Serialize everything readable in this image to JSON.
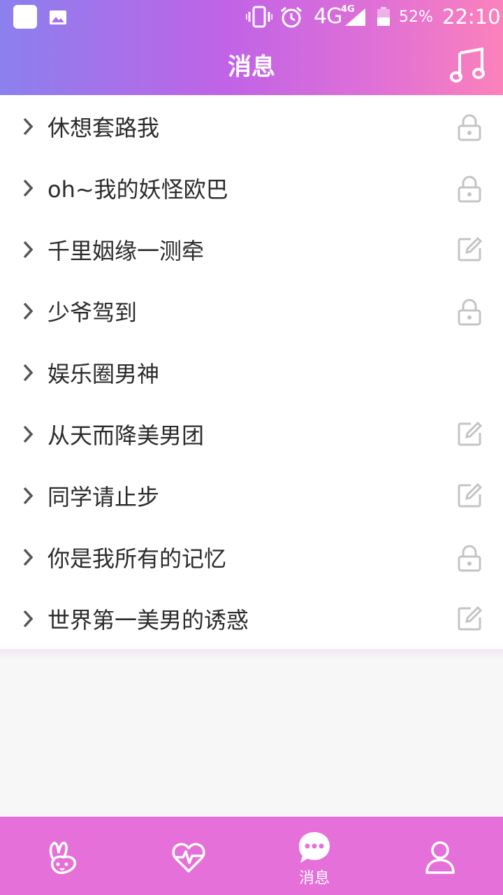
{
  "status_bar": {
    "network": "4G",
    "network_small": "4G",
    "battery": "52%",
    "time": "22:10",
    "icons": [
      "app-icon",
      "image-icon",
      "vibrate-icon",
      "alarm-icon",
      "signal-icon",
      "battery-icon"
    ]
  },
  "header": {
    "title": "消息",
    "action_icon": "music-note-icon"
  },
  "messages": [
    {
      "label": "休想套路我",
      "icon": "lock-icon"
    },
    {
      "label": "oh~我的妖怪欧巴",
      "icon": "lock-icon"
    },
    {
      "label": "千里姻缘一测牵",
      "icon": "edit-icon"
    },
    {
      "label": "少爷驾到",
      "icon": "lock-icon"
    },
    {
      "label": "娱乐圈男神",
      "icon": ""
    },
    {
      "label": "从天而降美男团",
      "icon": "edit-icon"
    },
    {
      "label": "同学请止步",
      "icon": "edit-icon"
    },
    {
      "label": "你是我所有的记忆",
      "icon": "lock-icon"
    },
    {
      "label": "世界第一美男的诱惑",
      "icon": "edit-icon"
    }
  ],
  "tabbar": {
    "tabs": [
      {
        "icon": "rabbit-icon",
        "label": ""
      },
      {
        "icon": "heart-pulse-icon",
        "label": ""
      },
      {
        "icon": "chat-bubble-icon",
        "label": "消息",
        "active": true
      },
      {
        "icon": "profile-icon",
        "label": ""
      }
    ]
  },
  "colors": {
    "header_gradient": [
      "#8b80ee",
      "#c063e6",
      "#fc82bb"
    ],
    "tabbar": "#e570d9",
    "row_text": "#2b2b2b",
    "row_icon": "#c4c4c4"
  }
}
